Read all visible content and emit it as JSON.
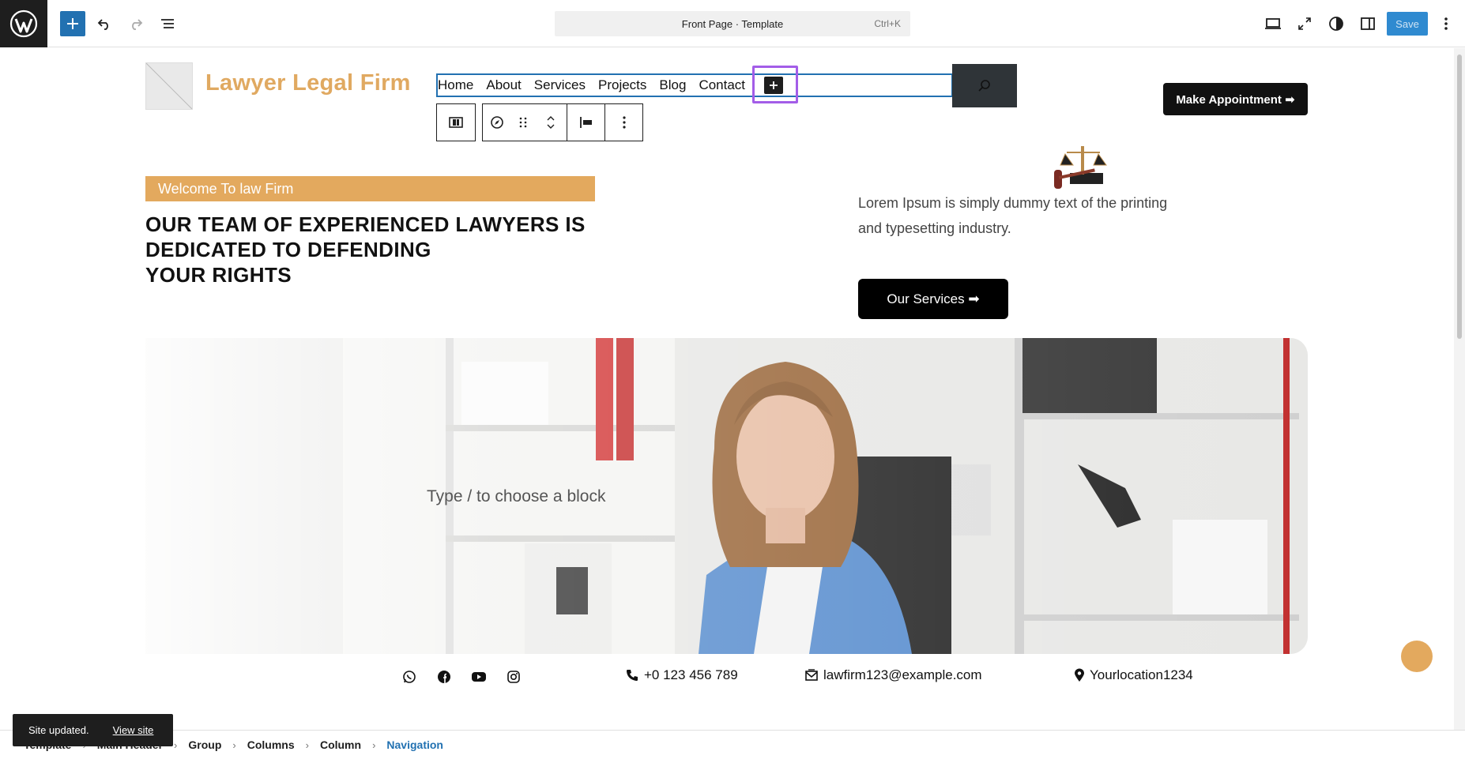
{
  "editor": {
    "document_title": "Front Page · Template",
    "shortcut": "Ctrl+K",
    "save_label": "Save"
  },
  "site": {
    "title": "Lawyer Legal Firm",
    "nav_items": [
      "Home",
      "About",
      "Services",
      "Projects",
      "Blog",
      "Contact"
    ],
    "appointment_label": "Make Appointment ➡",
    "welcome_label": "Welcome To law Firm",
    "heading_lines": [
      "OUR TEAM OF EXPERIENCED LAWYERS IS",
      "DEDICATED TO DEFENDING",
      "YOUR RIGHTS"
    ],
    "lorem": "Lorem Ipsum is simply dummy text of the printing and typesetting industry.",
    "services_label": "Our Services ➡",
    "block_placeholder": "Type / to choose a block",
    "phone": "+0 123 456 789",
    "email": "lawfirm123@example.com",
    "location": "Yourlocation1234"
  },
  "breadcrumb": [
    "Template",
    "Main Header",
    "Group",
    "Columns",
    "Column",
    "Navigation"
  ],
  "snackbar": {
    "message": "Site updated.",
    "link": "View site"
  },
  "colors": {
    "accent": "#e3a95e",
    "wp_blue": "#2271b1",
    "selection_purple": "#a35de8"
  }
}
